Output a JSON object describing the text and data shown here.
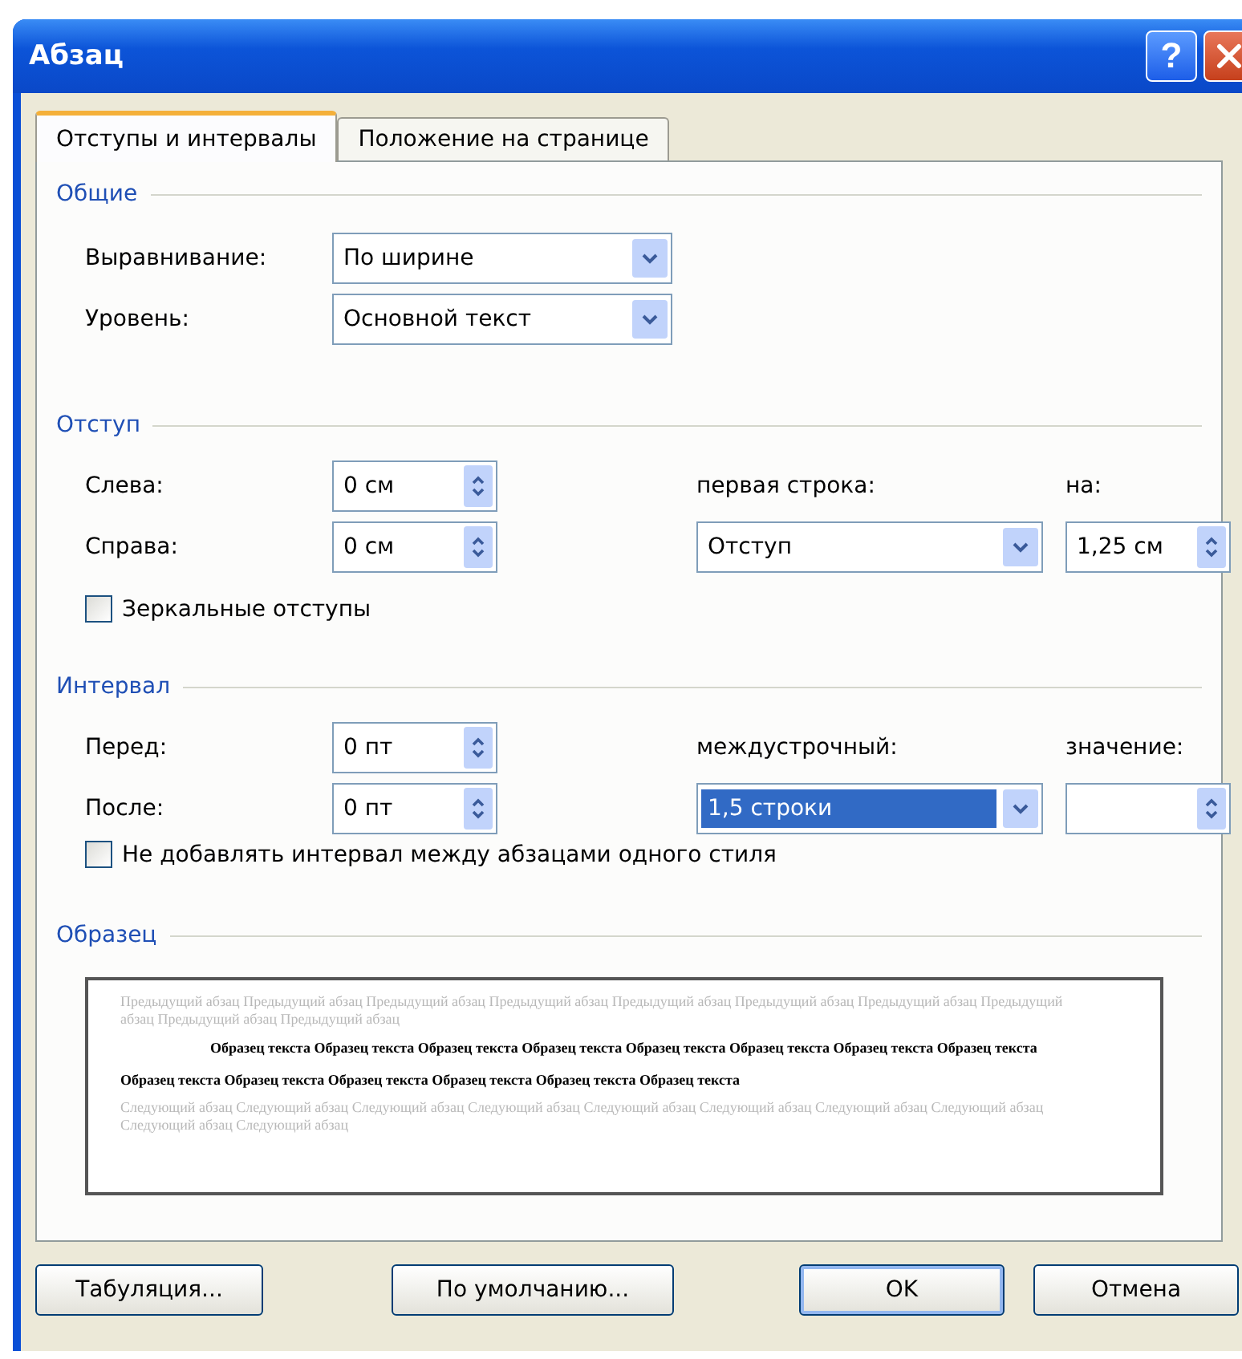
{
  "window": {
    "title": "Абзац",
    "help": "?"
  },
  "tabs": [
    {
      "label": "Отступы и интервалы",
      "selected": true
    },
    {
      "label": "Положение на странице",
      "selected": false
    }
  ],
  "general": {
    "title": "Общие",
    "fields": [
      {
        "label": "Выравнивание:",
        "value": "По ширине"
      },
      {
        "label": "Уровень:",
        "value": "Основной текст"
      }
    ]
  },
  "indent": {
    "title": "Отступ",
    "left": {
      "label": "Слева:",
      "value": "0 см"
    },
    "right": {
      "label": "Справа:",
      "value": "0 см"
    },
    "first_line": {
      "label": "первая строка:",
      "value": "Отступ"
    },
    "by": {
      "label": "на:",
      "value": "1,25 см"
    },
    "mirror": {
      "label": "Зеркальные отступы",
      "checked": false
    }
  },
  "spacing": {
    "title": "Интервал",
    "before": {
      "label": "Перед:",
      "value": "0 пт"
    },
    "after": {
      "label": "После:",
      "value": "0 пт"
    },
    "line_spacing": {
      "label": "междустрочный:",
      "value": "1,5 строки",
      "selected": true
    },
    "at": {
      "label": "значение:"
    },
    "no_space": {
      "label": "Не добавлять интервал между абзацами одного стиля",
      "checked": false
    }
  },
  "preview": {
    "title": "Образец",
    "previous_text": "Предыдущий абзац Предыдущий абзац Предыдущий абзац Предыдущий абзац Предыдущий абзац Предыдущий абзац Предыдущий абзац Предыдущий абзац Предыдущий абзац Предыдущий абзац",
    "sample_text": "Образец текста Образец текста Образец текста Образец текста Образец текста Образец текста Образец текста Образец текста Образец текста Образец текста Образец текста Образец текста Образец текста Образец текста",
    "next_text": "Следующий абзац Следующий абзац Следующий абзац Следующий абзац Следующий абзац Следующий абзац Следующий абзац Следующий абзац Следующий абзац Следующий абзац"
  },
  "buttons": [
    {
      "label": "Табуляция...",
      "default": false
    },
    {
      "label": "По умолчанию...",
      "default": false
    },
    {
      "label": "OK",
      "default": true
    },
    {
      "label": "Отмена",
      "default": false
    }
  ]
}
